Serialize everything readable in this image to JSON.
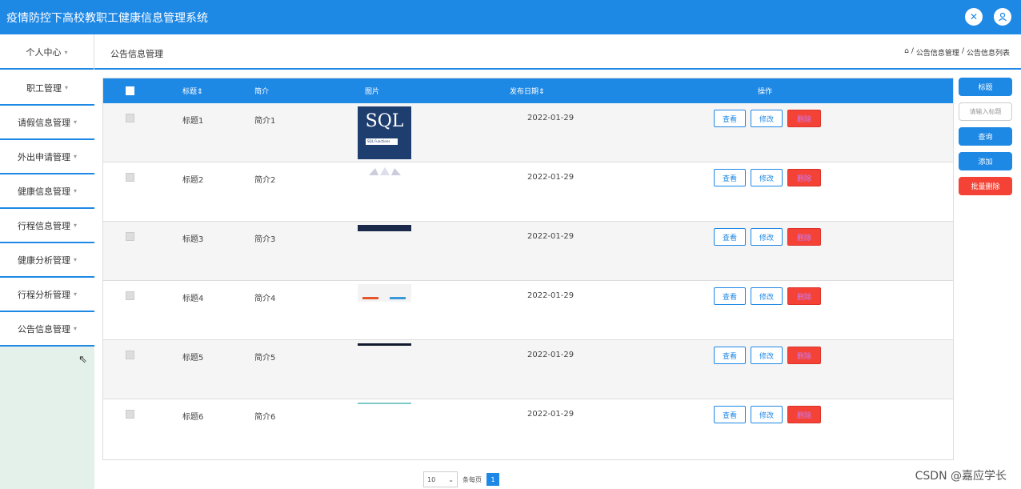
{
  "app": {
    "title": "疫情防控下高校教职工健康信息管理系统"
  },
  "header": {
    "expand_icon": "expand-icon",
    "user_icon": "user-icon"
  },
  "subbar": {
    "personal_center": "个人中心",
    "page_title": "公告信息管理",
    "breadcrumb": [
      "公告信息管理",
      "公告信息列表"
    ]
  },
  "sidebar": {
    "items": [
      {
        "label": "职工管理"
      },
      {
        "label": "请假信息管理"
      },
      {
        "label": "外出申请管理"
      },
      {
        "label": "健康信息管理"
      },
      {
        "label": "行程信息管理"
      },
      {
        "label": "健康分析管理"
      },
      {
        "label": "行程分析管理"
      },
      {
        "label": "公告信息管理"
      }
    ]
  },
  "table": {
    "headers": {
      "title": "标题",
      "intro": "简介",
      "picture": "图片",
      "date": "发布日期",
      "ops": "操作"
    },
    "sort_glyph": "⇕",
    "rows": [
      {
        "title": "标题1",
        "intro": "简介1",
        "date": "2022-01-29",
        "pic_text": "SQL",
        "pic_tag": "SQL Functions"
      },
      {
        "title": "标题2",
        "intro": "简介2",
        "date": "2022-01-29"
      },
      {
        "title": "标题3",
        "intro": "简介3",
        "date": "2022-01-29"
      },
      {
        "title": "标题4",
        "intro": "简介4",
        "date": "2022-01-29"
      },
      {
        "title": "标题5",
        "intro": "简介5",
        "date": "2022-01-29"
      },
      {
        "title": "标题6",
        "intro": "简介6",
        "date": "2022-01-29"
      }
    ],
    "actions": {
      "view": "查看",
      "edit": "修改",
      "delete": "删除"
    }
  },
  "right_panel": {
    "title_label": "标题",
    "title_placeholder": "请输入标题",
    "query": "查询",
    "add": "添加",
    "batch_delete": "批量删除"
  },
  "pager": {
    "page_size": "10",
    "per_page": "条每页",
    "current_page": "1"
  },
  "watermark": "CSDN @嘉应学长",
  "colors": {
    "primary": "#1e88e5",
    "danger": "#f44336",
    "sidebar_bg": "#e3f1ea"
  }
}
